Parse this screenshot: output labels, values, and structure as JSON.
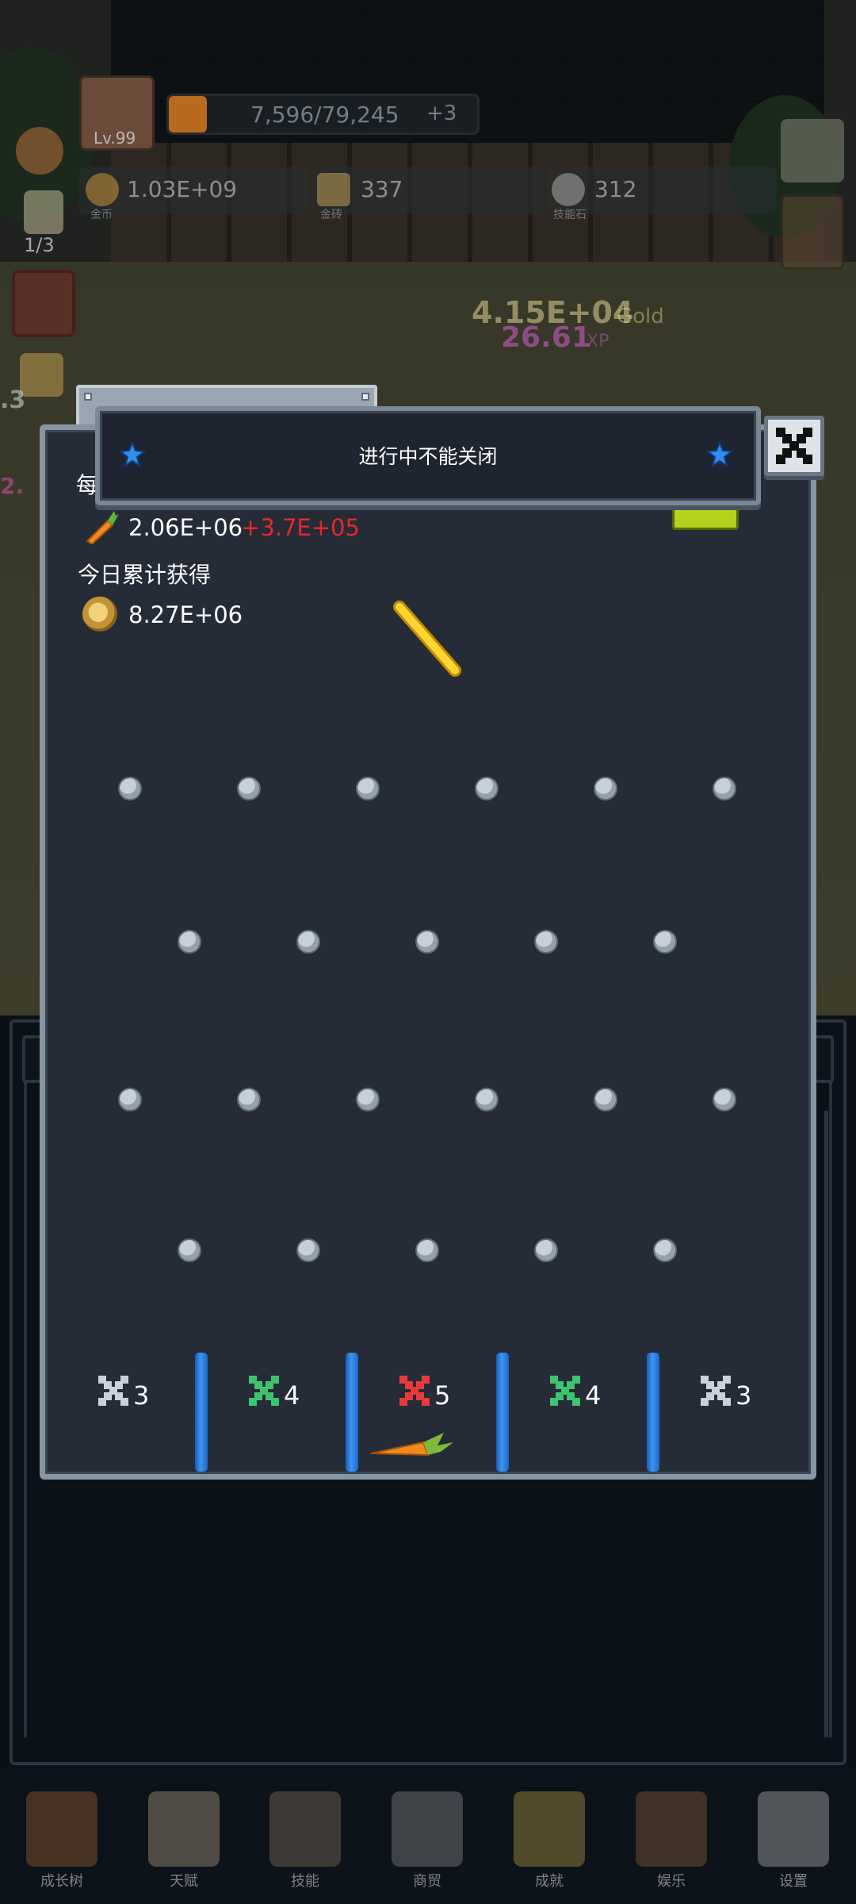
{
  "background": {
    "level": "Lv.99",
    "xp_progress": "7,596/79,245",
    "xp_bonus": "+3",
    "resources": [
      {
        "value": "1.03E+09",
        "label": "金币"
      },
      {
        "value": "337",
        "label": "金砖"
      },
      {
        "value": "312",
        "label": "技能石"
      }
    ],
    "floating_gold": "4.15E+04",
    "floating_gold_unit": "Gold",
    "floating_xp": "26.61",
    "floating_xp_unit": "XP",
    "side_counter": "1/3",
    "side_counter2": ".3",
    "side_counter3": "2."
  },
  "popup": {
    "title": "进行中不能关闭",
    "row1_label": "每",
    "row1_value": "2.06E+06",
    "row1_delta": "+3.7E+05",
    "row2_label": "今日累计获得",
    "row2_value": "8.27E+06",
    "slots": [
      {
        "multiplier": "3",
        "color": "#c9d1d9"
      },
      {
        "multiplier": "4",
        "color": "#3ec46d"
      },
      {
        "multiplier": "5",
        "color": "#e83a3a"
      },
      {
        "multiplier": "4",
        "color": "#3ec46d"
      },
      {
        "multiplier": "3",
        "color": "#c9d1d9"
      }
    ],
    "icons": {
      "close": "close-icon",
      "star": "star-icon",
      "carrot": "carrot-icon",
      "coin": "coin-icon"
    }
  },
  "bottom_nav": [
    {
      "label": "成长树",
      "icon": "book-icon"
    },
    {
      "label": "天赋",
      "icon": "scroll-icon"
    },
    {
      "label": "技能",
      "icon": "sword-icon"
    },
    {
      "label": "商贸",
      "icon": "map-icon"
    },
    {
      "label": "成就",
      "icon": "key-icon"
    },
    {
      "label": "娱乐",
      "icon": "parchment-icon"
    },
    {
      "label": "设置",
      "icon": "gear-icon"
    }
  ],
  "colors": {
    "panel_bg": "#252c37",
    "panel_border": "#8895a2",
    "divider_blue": "#3d95f2",
    "delta_red": "#e62828"
  }
}
